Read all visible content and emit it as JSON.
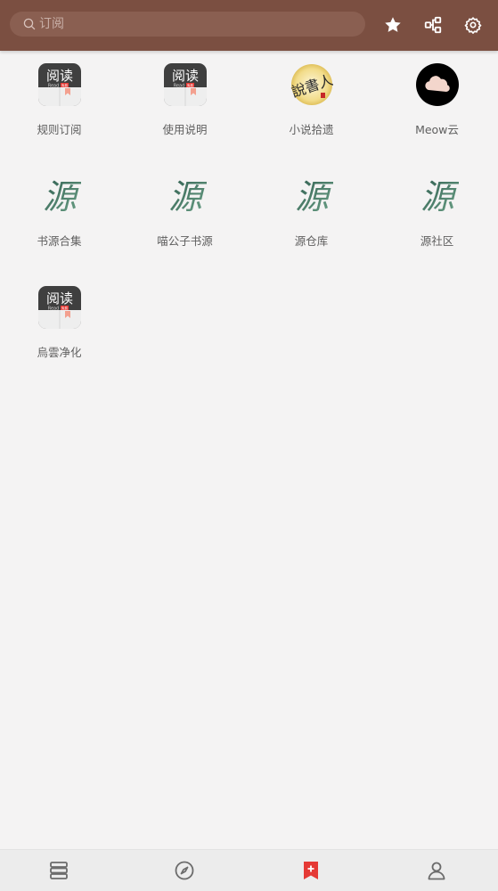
{
  "search": {
    "placeholder": "订阅",
    "value": ""
  },
  "toolbar": {
    "icons": [
      "star-icon",
      "share-nodes-icon",
      "gear-icon"
    ]
  },
  "sources": [
    {
      "label": "规则订阅",
      "icon": "legado-app-icon"
    },
    {
      "label": "使用说明",
      "icon": "legado-app-icon"
    },
    {
      "label": "小说拾遗",
      "icon": "seal-calligraphy-icon"
    },
    {
      "label": "Meow云",
      "icon": "cloud-icon"
    },
    {
      "label": "书源合集",
      "icon": "yuan-calligraphy-icon"
    },
    {
      "label": "喵公子书源",
      "icon": "yuan-calligraphy-icon"
    },
    {
      "label": "源仓库",
      "icon": "yuan-calligraphy-icon"
    },
    {
      "label": "源社区",
      "icon": "yuan-calligraphy-icon"
    },
    {
      "label": "烏雲净化",
      "icon": "legado-app-icon"
    }
  ],
  "app_icon_text": {
    "title": "阅读",
    "subtitle": "Read",
    "badge": "免费"
  },
  "calligraphy": {
    "yuan": "源",
    "seal": "說書人"
  },
  "bottom_nav": [
    {
      "name": "bookshelf",
      "active": false
    },
    {
      "name": "discover",
      "active": false
    },
    {
      "name": "subscribe",
      "active": true
    },
    {
      "name": "my",
      "active": false
    }
  ],
  "colors": {
    "topbar": "#7b4f41",
    "accent": "#e53935",
    "nav_icon": "#6b6b6b",
    "background": "#f4f3f3"
  }
}
